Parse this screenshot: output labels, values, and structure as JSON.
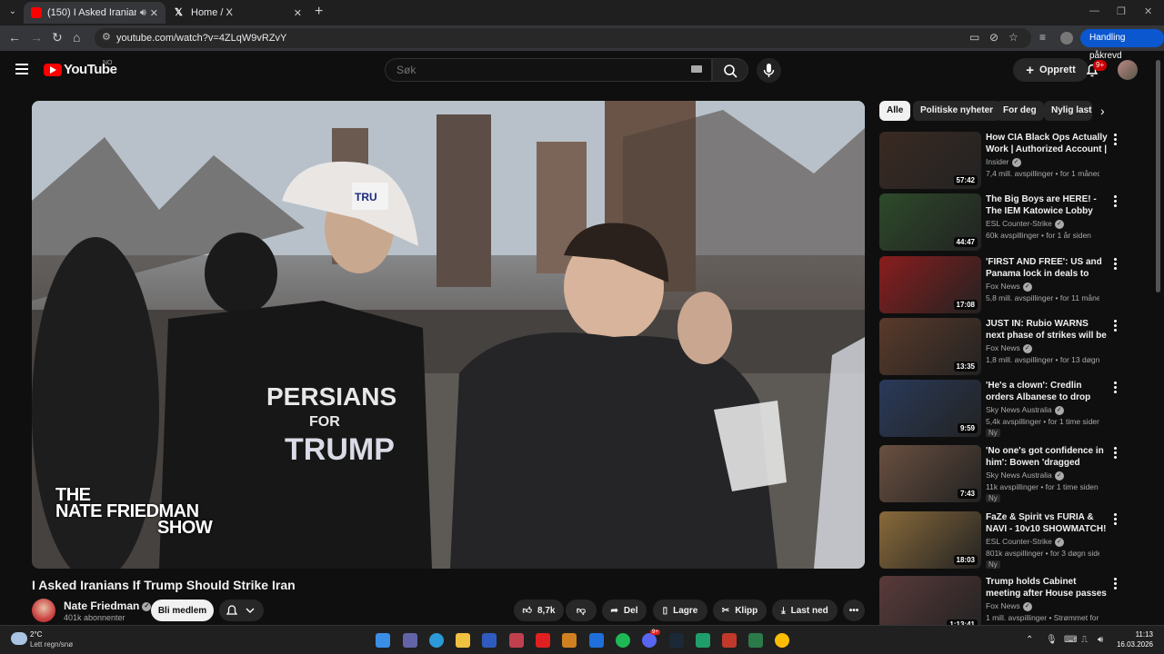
{
  "browser": {
    "tabs": [
      {
        "title": "(150) I Asked Iranians If Trum",
        "active": true
      },
      {
        "title": "Home / X",
        "active": false
      }
    ],
    "url": "youtube.com/watch?v=4ZLqW9vRZvY",
    "action_required": "Handling påkrevd"
  },
  "header": {
    "logo": "YouTube",
    "country_code": "NO",
    "search_placeholder": "Søk",
    "create_label": "Opprett",
    "notifications": "9+"
  },
  "video": {
    "title": "I Asked Iranians If Trump Should Strike Iran",
    "watermark": [
      "THE",
      "NATE FRIEDMAN",
      "SHOW"
    ],
    "channel": "Nate Friedman",
    "subscribers": "401k abonnenter",
    "join_label": "Bli medlem",
    "likes": "8,7k",
    "share_label": "Del",
    "save_label": "Lagre",
    "clip_label": "Klipp",
    "download_label": "Last ned"
  },
  "chips": [
    "Alle",
    "Politiske nyheter",
    "For deg",
    "Nylig lastet opp"
  ],
  "recommendations": [
    {
      "title": "How CIA Black Ops Actually Work | Authorized Account | ...",
      "channel": "Insider",
      "meta": "7,4 mill. avspillinger • for 1 måned siden",
      "duration": "57:42",
      "new": "",
      "thumb": "#3a2a22"
    },
    {
      "title": "The Big Boys are HERE! - The IEM Katowice Lobby",
      "channel": "ESL Counter-Strike",
      "meta": "60k avspillinger • for 1 år siden",
      "duration": "44:47",
      "new": "",
      "thumb": "#2d4a2a"
    },
    {
      "title": "'FIRST AND FREE': US and Panama lock in deals to deter ...",
      "channel": "Fox News",
      "meta": "5,8 mill. avspillinger • for 11 måneder siden",
      "duration": "17:08",
      "new": "",
      "thumb": "#8a1d1d"
    },
    {
      "title": "JUST IN: Rubio WARNS next phase of strikes will be even ...",
      "channel": "Fox News",
      "meta": "1,8 mill. avspillinger • for 13 døgn siden",
      "duration": "13:35",
      "new": "",
      "thumb": "#5a3a2a"
    },
    {
      "title": "'He's a clown': Credlin orders Albanese to drop 'incompetent...",
      "channel": "Sky News Australia",
      "meta": "5,4k avspillinger • for 1 time siden",
      "duration": "9:59",
      "new": "Ny",
      "thumb": "#2a3a5a"
    },
    {
      "title": "'No one's got confidence in him': Bowen 'dragged kicking and ...",
      "channel": "Sky News Australia",
      "meta": "11k avspillinger • for 1 time siden",
      "duration": "7:43",
      "new": "Ny",
      "thumb": "#6a5040"
    },
    {
      "title": "FaZe & Spirit vs FURIA & NAVI - 10v10 SHOWMATCH!",
      "channel": "ESL Counter-Strike",
      "meta": "801k avspillinger • for 3 døgn siden",
      "duration": "18:03",
      "new": "Ny",
      "thumb": "#8a6a3a"
    },
    {
      "title": "Trump holds Cabinet meeting after House passes budget bill",
      "channel": "Fox News",
      "meta": "1 mill. avspillinger • Strømmet for 11 måneder siden",
      "duration": "1:13:41",
      "new": "",
      "thumb": "#5a3a3a"
    }
  ],
  "taskbar": {
    "temperature": "2°C",
    "weather": "Lett regn/snø",
    "time": "11:13",
    "date": "16.03.2026",
    "discord_badge": "9+"
  }
}
